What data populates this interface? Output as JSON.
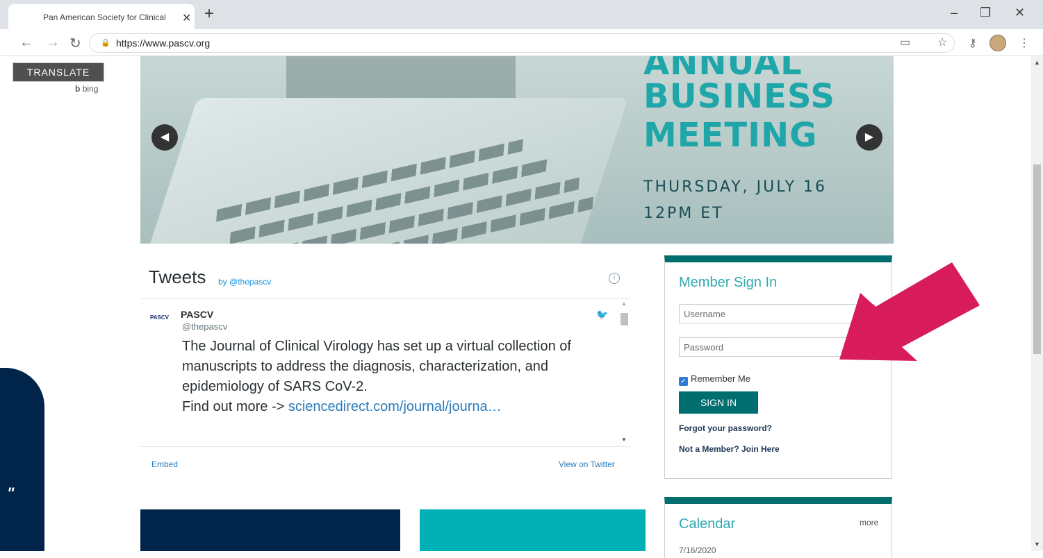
{
  "browser": {
    "tab_title": "Pan American Society for Clinical",
    "url": "https://www.pascv.org"
  },
  "translate": {
    "button": "TRANSLATE",
    "powered_by": "bing"
  },
  "hero": {
    "line1": "ANNUAL",
    "line2": "BUSINESS",
    "line3": "MEETING",
    "date": "THURSDAY, JULY 16",
    "time": "12PM ET"
  },
  "tweets": {
    "title": "Tweets",
    "by": "by @thepascv",
    "logo_text": "PASCV",
    "name": "PASCV",
    "handle": "@thepascv",
    "text": "The Journal of Clinical Virology has set up a virtual collection of manuscripts to address the diagnosis, characterization, and epidemiology of SARS CoV-2.",
    "more_prefix": "Find out more -> ",
    "link": "sciencedirect.com/journal/journa…",
    "embed": "Embed",
    "view_on_twitter": "View on Twitter"
  },
  "signin": {
    "title": "Member Sign In",
    "username_placeholder": "Username",
    "password_placeholder": "Password",
    "remember": "Remember Me",
    "button": "SIGN IN",
    "forgot": "Forgot your password?",
    "join": "Not a Member? Join Here"
  },
  "calendar": {
    "title": "Calendar",
    "more": "more",
    "first_date": "7/16/2020"
  },
  "colors": {
    "teal": "#006e6e",
    "accent": "#2fa9b0",
    "navy": "#00244a",
    "arrow": "#d81b5a"
  },
  "left_panel": {
    "quote": "\""
  }
}
